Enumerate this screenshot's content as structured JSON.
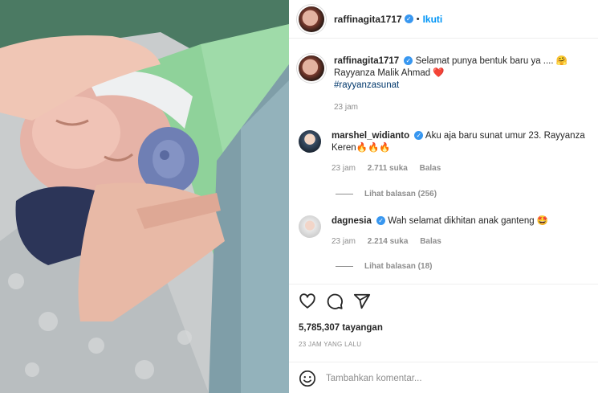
{
  "post": {
    "author": "raffinagita1717",
    "follow_label": "Ikuti",
    "separator": "•"
  },
  "caption": {
    "username": "raffinagita1717",
    "text": "Selamat punya bentuk baru ya .... 🤗",
    "line2": "Rayyanza Malik Ahmad ❤️",
    "hashtag": "#rayyanzasunat",
    "time": "23 jam"
  },
  "comments": [
    {
      "username": "marshel_widianto",
      "text": "Aku aja baru sunat umur 23. Rayyanza",
      "text2": "Keren🔥🔥🔥",
      "time": "23 jam",
      "likes": "2.711 suka",
      "reply": "Balas",
      "view_replies": "Lihat balasan (256)"
    },
    {
      "username": "dagnesia",
      "text": "Wah selamat dikhitan anak ganteng 🤩",
      "time": "23 jam",
      "likes": "2.214 suka",
      "reply": "Balas",
      "view_replies": "Lihat balasan (18)"
    }
  ],
  "stats": {
    "views": "5,785,307 tayangan",
    "time_ago": "23 JAM YANG LALU"
  },
  "composer": {
    "placeholder": "Tambahkan komentar..."
  },
  "colors": {
    "link_blue": "#0095f6",
    "verified_blue": "#3897f0",
    "hashtag": "#00376b",
    "muted": "#8e8e8e"
  },
  "icons": [
    "heart-icon",
    "comment-icon",
    "share-icon",
    "emoji-icon",
    "verified-icon"
  ]
}
